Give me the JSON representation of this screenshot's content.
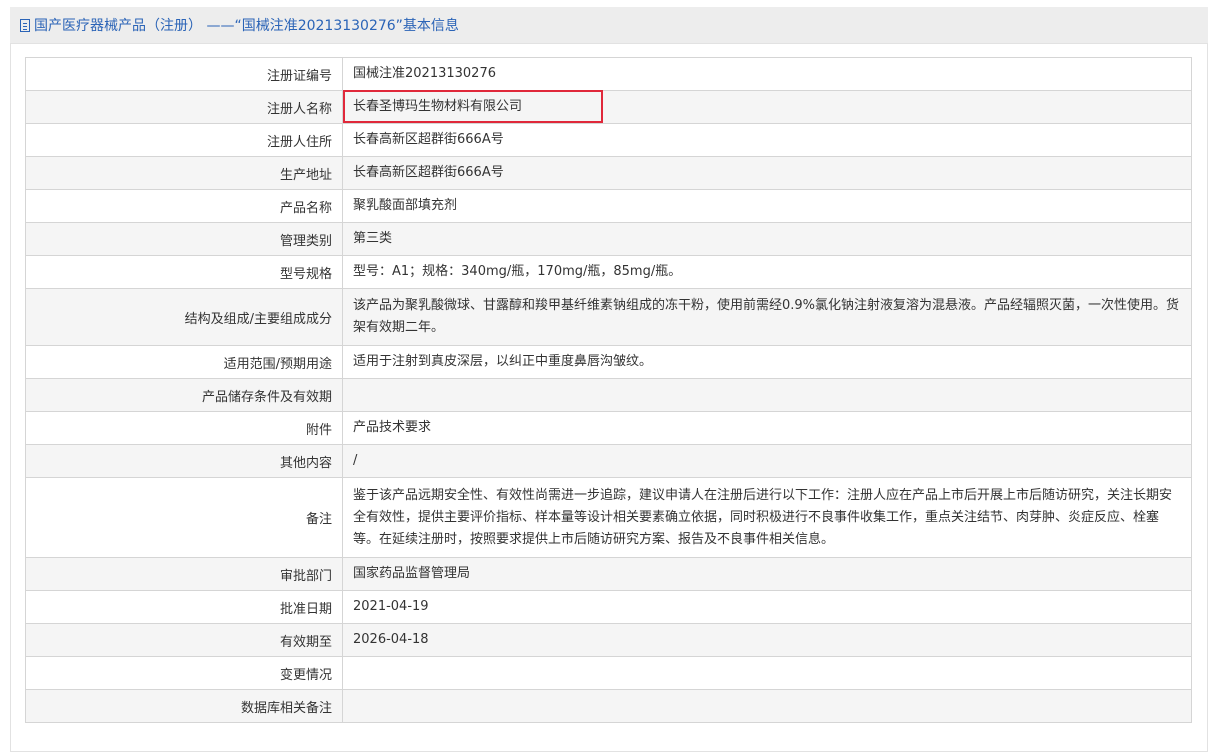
{
  "header": {
    "title": "国产医疗器械产品（注册）  ——“国械注准20213130276”基本信息"
  },
  "rows": [
    {
      "label": "注册证编号",
      "value": "国械注准20213130276"
    },
    {
      "label": "注册人名称",
      "value": "长春圣博玛生物材料有限公司"
    },
    {
      "label": "注册人住所",
      "value": "长春高新区超群街666A号"
    },
    {
      "label": "生产地址",
      "value": "长春高新区超群街666A号"
    },
    {
      "label": "产品名称",
      "value": "聚乳酸面部填充剂"
    },
    {
      "label": "管理类别",
      "value": "第三类"
    },
    {
      "label": "型号规格",
      "value": "型号：A1；规格：340mg/瓶，170mg/瓶，85mg/瓶。"
    },
    {
      "label": "结构及组成/主要组成成分",
      "value": "该产品为聚乳酸微球、甘露醇和羧甲基纤维素钠组成的冻干粉，使用前需经0.9%氯化钠注射液复溶为混悬液。产品经辐照灭菌，一次性使用。货架有效期二年。"
    },
    {
      "label": "适用范围/预期用途",
      "value": "适用于注射到真皮深层，以纠正中重度鼻唇沟皱纹。"
    },
    {
      "label": "产品储存条件及有效期",
      "value": ""
    },
    {
      "label": "附件",
      "value": "产品技术要求"
    },
    {
      "label": "其他内容",
      "value": "/"
    },
    {
      "label": "备注",
      "value": "鉴于该产品远期安全性、有效性尚需进一步追踪，建议申请人在注册后进行以下工作：注册人应在产品上市后开展上市后随访研究，关注长期安全有效性，提供主要评价指标、样本量等设计相关要素确立依据，同时积极进行不良事件收集工作，重点关注结节、肉芽肿、炎症反应、栓塞等。在延续注册时，按照要求提供上市后随访研究方案、报告及不良事件相关信息。"
    },
    {
      "label": "审批部门",
      "value": "国家药品监督管理局"
    },
    {
      "label": "批准日期",
      "value": "2021-04-19"
    },
    {
      "label": "有效期至",
      "value": "2026-04-18"
    },
    {
      "label": "变更情况",
      "value": ""
    },
    {
      "label": "数据库相关备注",
      "value": ""
    }
  ]
}
